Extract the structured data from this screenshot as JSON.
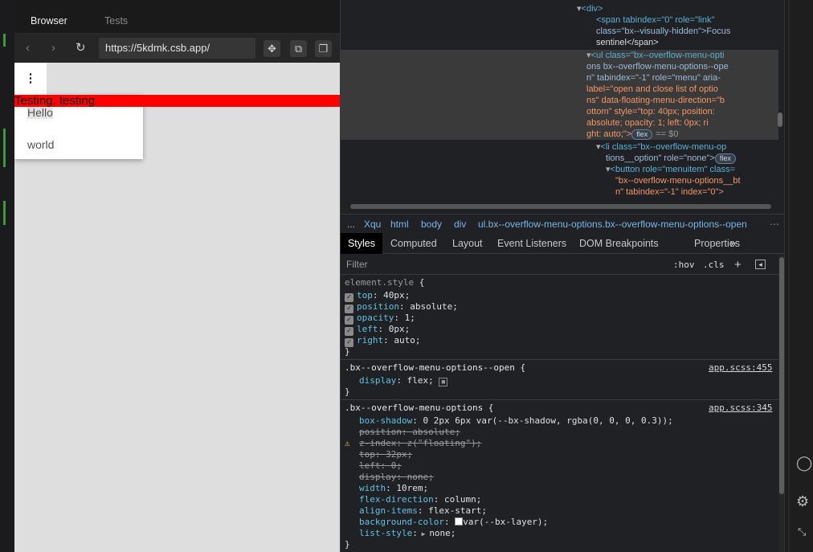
{
  "browser": {
    "tabs": [
      {
        "label": "Browser",
        "active": true
      },
      {
        "label": "Tests",
        "active": false
      }
    ],
    "url": "https://5kdmk.csb.app/",
    "icons": [
      "back-arrow-icon",
      "forward-arrow-icon",
      "reload-icon",
      "move-icon",
      "copy-icon",
      "new-window-icon"
    ]
  },
  "page": {
    "menu_trigger": "⋮",
    "banner_text": "Testing, testing",
    "menu_options": [
      "Hello",
      "world"
    ]
  },
  "devtools": {
    "elements": {
      "div_open": "<div>",
      "span_open": "<span tabindex=\"0\" role=\"link\"",
      "span_class": "class=\"bx--visually-hidden\">Focus",
      "span_close": "sentinel</span>",
      "ul_line1": "<ul class=\"bx--overflow-menu-opti",
      "ul_line2": "ons bx--overflow-menu-options--ope",
      "ul_line3": "n\" tabindex=\"-1\" role=\"menu\" aria-",
      "ul_line4": "label=\"open and close list of optio",
      "ul_line5": "ns\" data-floating-menu-direction=\"b",
      "ul_line6": "ottom\" style=\"top: 40px; position:",
      "ul_line7": "absolute; opacity: 1; left: 0px; ri",
      "ul_line8": "ght: auto;\">",
      "ul_pill": "flex",
      "ul_eq": "== $0",
      "li_line1": "<li class=\"bx--overflow-menu-op",
      "li_line2": "tions__option\" role=\"none\">",
      "li_pill": "flex",
      "btn_line1": "<button role=\"menuitem\" class=",
      "btn_line2": "\"bx--overflow-menu-options__bt",
      "btn_line3": "n\" tabindex=\"-1\" index=\"0\">"
    },
    "breadcrumbs": [
      "...",
      "Xqu",
      "html",
      "body",
      "div",
      "ul.bx--overflow-menu-options.bx--overflow-menu-options--open"
    ],
    "style_tabs": [
      "Styles",
      "Computed",
      "Layout",
      "Event Listeners",
      "DOM Breakpoints",
      "Properties",
      "»"
    ],
    "filter_placeholder": "Filter",
    "filter_hov": ":hov",
    "filter_cls": ".cls",
    "filter_plus": "+",
    "element_style": {
      "selector": "element.style {",
      "props": [
        {
          "name": "top",
          "value": "40px;"
        },
        {
          "name": "position",
          "value": "absolute;"
        },
        {
          "name": "opacity",
          "value": "1;"
        },
        {
          "name": "left",
          "value": "0px;"
        },
        {
          "name": "right",
          "value": "auto;"
        }
      ],
      "close": "}"
    },
    "rule_open": {
      "selector": ".bx--overflow-menu-options--open {",
      "source": "app.scss:455",
      "props": [
        {
          "name": "display",
          "value": "flex;"
        }
      ],
      "close": "}"
    },
    "rule_options": {
      "selector": ".bx--overflow-menu-options {",
      "source": "app.scss:345",
      "props": [
        {
          "name": "box-shadow",
          "value": "0 2px 6px var(--bx-shadow, rgba(0, 0, 0, 0.3));",
          "struck": false
        },
        {
          "name": "position",
          "value": "absolute;",
          "struck": true
        },
        {
          "name": "z-index",
          "value": "z(\"floating\");",
          "struck": true,
          "warning": true
        },
        {
          "name": "top",
          "value": "32px;",
          "struck": true
        },
        {
          "name": "left",
          "value": "0;",
          "struck": true
        },
        {
          "name": "display",
          "value": "none;",
          "struck": true
        },
        {
          "name": "width",
          "value": "10rem;",
          "struck": false
        },
        {
          "name": "flex-direction",
          "value": "column;",
          "struck": false
        },
        {
          "name": "align-items",
          "value": "flex-start;",
          "struck": false
        },
        {
          "name": "background-color",
          "value": "var(--bx-layer);",
          "struck": false,
          "swatch": true
        },
        {
          "name": "list-style",
          "value": "none;",
          "struck": false,
          "arrow": true
        }
      ],
      "close": "}"
    }
  },
  "colors": {
    "banner": "#ff0000",
    "devtools_bg": "#202124",
    "prop": "#5ec4e6"
  }
}
